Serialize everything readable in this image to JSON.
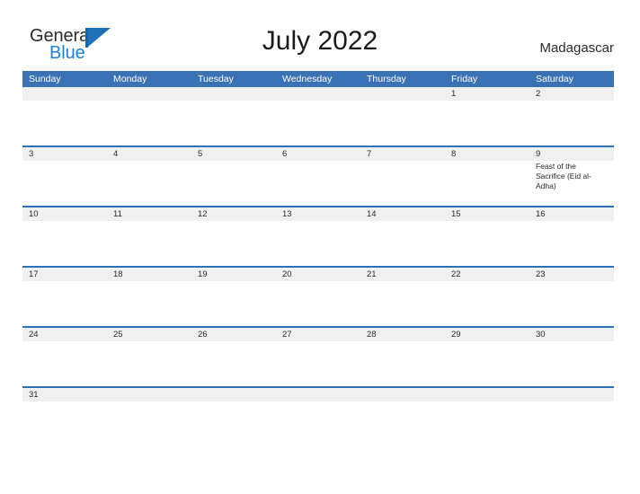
{
  "brand": {
    "name_part1": "General",
    "name_part2": "Blue",
    "flag_icon": "flag-triangle-icon"
  },
  "header": {
    "title": "July 2022",
    "country": "Madagascar"
  },
  "colors": {
    "header_blue": "#3a72b5",
    "row_border_blue": "#2f6fb5",
    "band_gray": "#f0f0f0",
    "brand_blue": "#1f7fd4",
    "text_dark": "#2b2b2b"
  },
  "weekdays": [
    "Sunday",
    "Monday",
    "Tuesday",
    "Wednesday",
    "Thursday",
    "Friday",
    "Saturday"
  ],
  "weeks": [
    [
      {
        "day": "",
        "event": ""
      },
      {
        "day": "",
        "event": ""
      },
      {
        "day": "",
        "event": ""
      },
      {
        "day": "",
        "event": ""
      },
      {
        "day": "",
        "event": ""
      },
      {
        "day": "1",
        "event": ""
      },
      {
        "day": "2",
        "event": ""
      }
    ],
    [
      {
        "day": "3",
        "event": ""
      },
      {
        "day": "4",
        "event": ""
      },
      {
        "day": "5",
        "event": ""
      },
      {
        "day": "6",
        "event": ""
      },
      {
        "day": "7",
        "event": ""
      },
      {
        "day": "8",
        "event": ""
      },
      {
        "day": "9",
        "event": "Feast of the Sacrifice (Eid al-Adha)"
      }
    ],
    [
      {
        "day": "10",
        "event": ""
      },
      {
        "day": "11",
        "event": ""
      },
      {
        "day": "12",
        "event": ""
      },
      {
        "day": "13",
        "event": ""
      },
      {
        "day": "14",
        "event": ""
      },
      {
        "day": "15",
        "event": ""
      },
      {
        "day": "16",
        "event": ""
      }
    ],
    [
      {
        "day": "17",
        "event": ""
      },
      {
        "day": "18",
        "event": ""
      },
      {
        "day": "19",
        "event": ""
      },
      {
        "day": "20",
        "event": ""
      },
      {
        "day": "21",
        "event": ""
      },
      {
        "day": "22",
        "event": ""
      },
      {
        "day": "23",
        "event": ""
      }
    ],
    [
      {
        "day": "24",
        "event": ""
      },
      {
        "day": "25",
        "event": ""
      },
      {
        "day": "26",
        "event": ""
      },
      {
        "day": "27",
        "event": ""
      },
      {
        "day": "28",
        "event": ""
      },
      {
        "day": "29",
        "event": ""
      },
      {
        "day": "30",
        "event": ""
      }
    ],
    [
      {
        "day": "31",
        "event": ""
      },
      {
        "day": "",
        "event": ""
      },
      {
        "day": "",
        "event": ""
      },
      {
        "day": "",
        "event": ""
      },
      {
        "day": "",
        "event": ""
      },
      {
        "day": "",
        "event": ""
      },
      {
        "day": "",
        "event": ""
      }
    ]
  ]
}
